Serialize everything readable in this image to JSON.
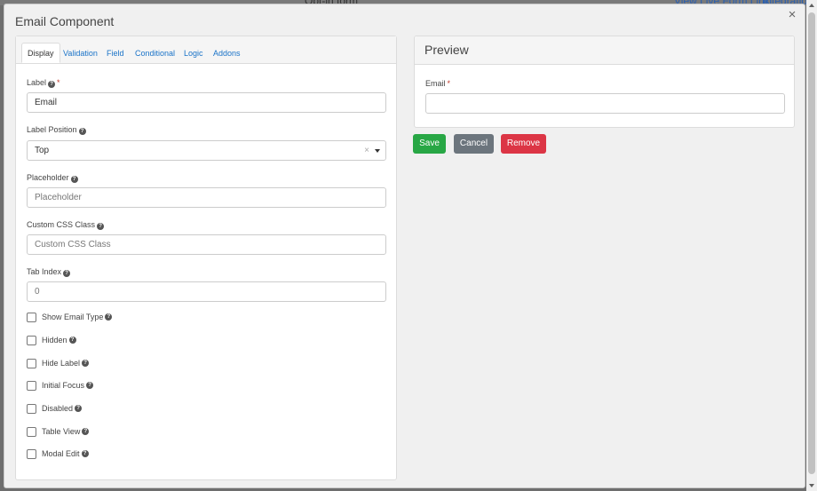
{
  "backdrop": {
    "center_text": "Opt-in form",
    "link1": "View Live Form Link",
    "link2": "Integration"
  },
  "modal": {
    "title": "Email Component",
    "close_label": "×"
  },
  "tabs": [
    {
      "label": "Display",
      "active": true
    },
    {
      "label": "Validation",
      "active": false
    },
    {
      "label": "Field",
      "active": false
    },
    {
      "label": "Conditional",
      "active": false
    },
    {
      "label": "Logic",
      "active": false
    },
    {
      "label": "Addons",
      "active": false
    }
  ],
  "fields": {
    "label": {
      "title": "Label",
      "required_mark": "*",
      "value": "Email"
    },
    "label_position": {
      "title": "Label Position",
      "value": "Top",
      "clear": "×"
    },
    "placeholder": {
      "title": "Placeholder",
      "placeholder": "Placeholder"
    },
    "custom_css": {
      "title": "Custom CSS Class",
      "placeholder": "Custom CSS Class"
    },
    "tab_index": {
      "title": "Tab Index",
      "placeholder": "0"
    }
  },
  "checkboxes": [
    {
      "label": "Show Email Type",
      "checked": false
    },
    {
      "label": "Hidden",
      "checked": false
    },
    {
      "label": "Hide Label",
      "checked": false
    },
    {
      "label": "Initial Focus",
      "checked": false
    },
    {
      "label": "Disabled",
      "checked": false
    },
    {
      "label": "Table View",
      "checked": false
    },
    {
      "label": "Modal Edit",
      "checked": false
    }
  ],
  "help_glyph": "?",
  "preview": {
    "title": "Preview",
    "field_label": "Email",
    "required_mark": "*"
  },
  "buttons": {
    "save": "Save",
    "cancel": "Cancel",
    "remove": "Remove"
  },
  "colors": {
    "save": "#28a745",
    "cancel": "#6c757d",
    "remove": "#dc3545",
    "link": "#1a73c8",
    "required": "#c0392b"
  }
}
